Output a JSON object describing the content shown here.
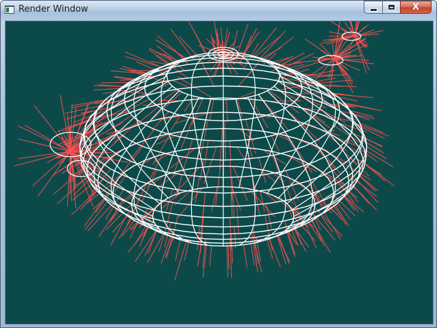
{
  "window": {
    "title": "Render Window",
    "background_color": "#0c4a4a",
    "icon": "app-icon"
  },
  "controls": {
    "minimize_icon": "minimize-icon",
    "maximize_icon": "maximize-icon",
    "close_icon": "close-icon",
    "close_glyph": "X"
  },
  "scene": {
    "object": "teapot-wireframe",
    "wire_color": "#ffffff",
    "normal_color": "#ff5050"
  }
}
